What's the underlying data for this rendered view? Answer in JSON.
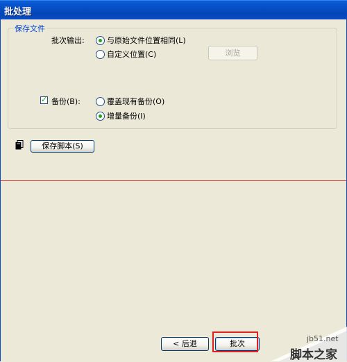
{
  "window": {
    "title": "批处理"
  },
  "group": {
    "legend": "保存文件"
  },
  "batch_output": {
    "label": "批次输出:",
    "options": [
      {
        "label": "与原始文件位置相同(L)",
        "checked": true
      },
      {
        "label": "自定义位置(C)",
        "checked": false
      }
    ],
    "browse_label": "浏览"
  },
  "backup": {
    "label": "备份(B):",
    "checked": true,
    "options": [
      {
        "label": "覆盖现有备份(O)",
        "checked": false
      },
      {
        "label": "增量备份(I)",
        "checked": true
      }
    ]
  },
  "save_script_label": "保存脚本(S)",
  "footer": {
    "back_label": "< 后退",
    "batch_label": "批次"
  },
  "watermark": {
    "site": "jb51.net",
    "name": "脚本之家"
  }
}
